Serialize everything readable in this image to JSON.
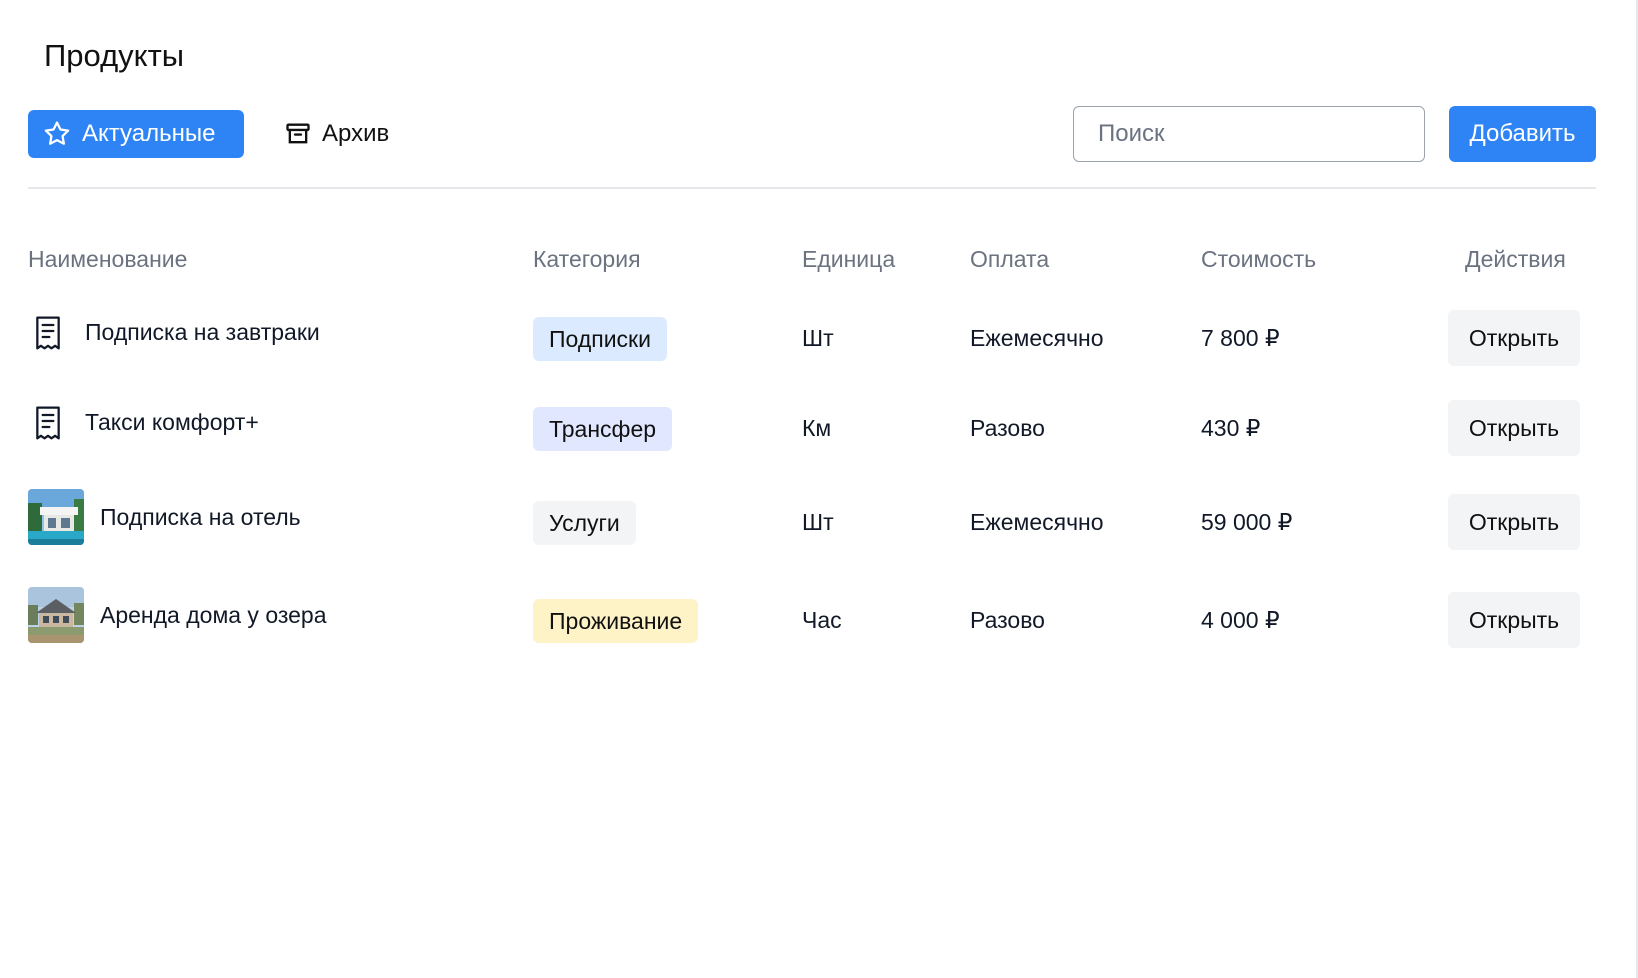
{
  "page": {
    "title": "Продукты"
  },
  "tabs": {
    "active_label": "Актуальные",
    "archive_label": "Архив"
  },
  "search": {
    "placeholder": "Поиск",
    "value": ""
  },
  "toolbar": {
    "add_label": "Добавить"
  },
  "table": {
    "headers": {
      "name": "Наименование",
      "category": "Категория",
      "unit": "Единица",
      "payment": "Оплата",
      "price": "Стоимость",
      "actions": "Действия"
    },
    "rows": [
      {
        "icon": "receipt-icon",
        "name": "Подписка на завтраки",
        "category": "Подписки",
        "category_color": "#dbeafe",
        "unit": "Шт",
        "payment": "Ежемесячно",
        "price": "7 800 ₽",
        "action": "Открыть"
      },
      {
        "icon": "receipt-icon",
        "name": "Такси комфорт+",
        "category": "Трансфер",
        "category_color": "#e0e7ff",
        "unit": "Км",
        "payment": "Разово",
        "price": "430 ₽",
        "action": "Открыть"
      },
      {
        "icon": "hotel-thumbnail",
        "name": "Подписка на отель",
        "category": "Услуги",
        "category_color": "#f3f4f6",
        "unit": "Шт",
        "payment": "Ежемесячно",
        "price": "59 000 ₽",
        "action": "Открыть"
      },
      {
        "icon": "lake-house-thumbnail",
        "name": "Аренда дома у озера",
        "category": "Проживание",
        "category_color": "#fef3c7",
        "unit": "Час",
        "payment": "Разово",
        "price": "4 000 ₽",
        "action": "Открыть"
      }
    ]
  },
  "colors": {
    "accent": "#2e84f5",
    "header_text": "#6b7280",
    "divider": "#e5e7eb"
  }
}
